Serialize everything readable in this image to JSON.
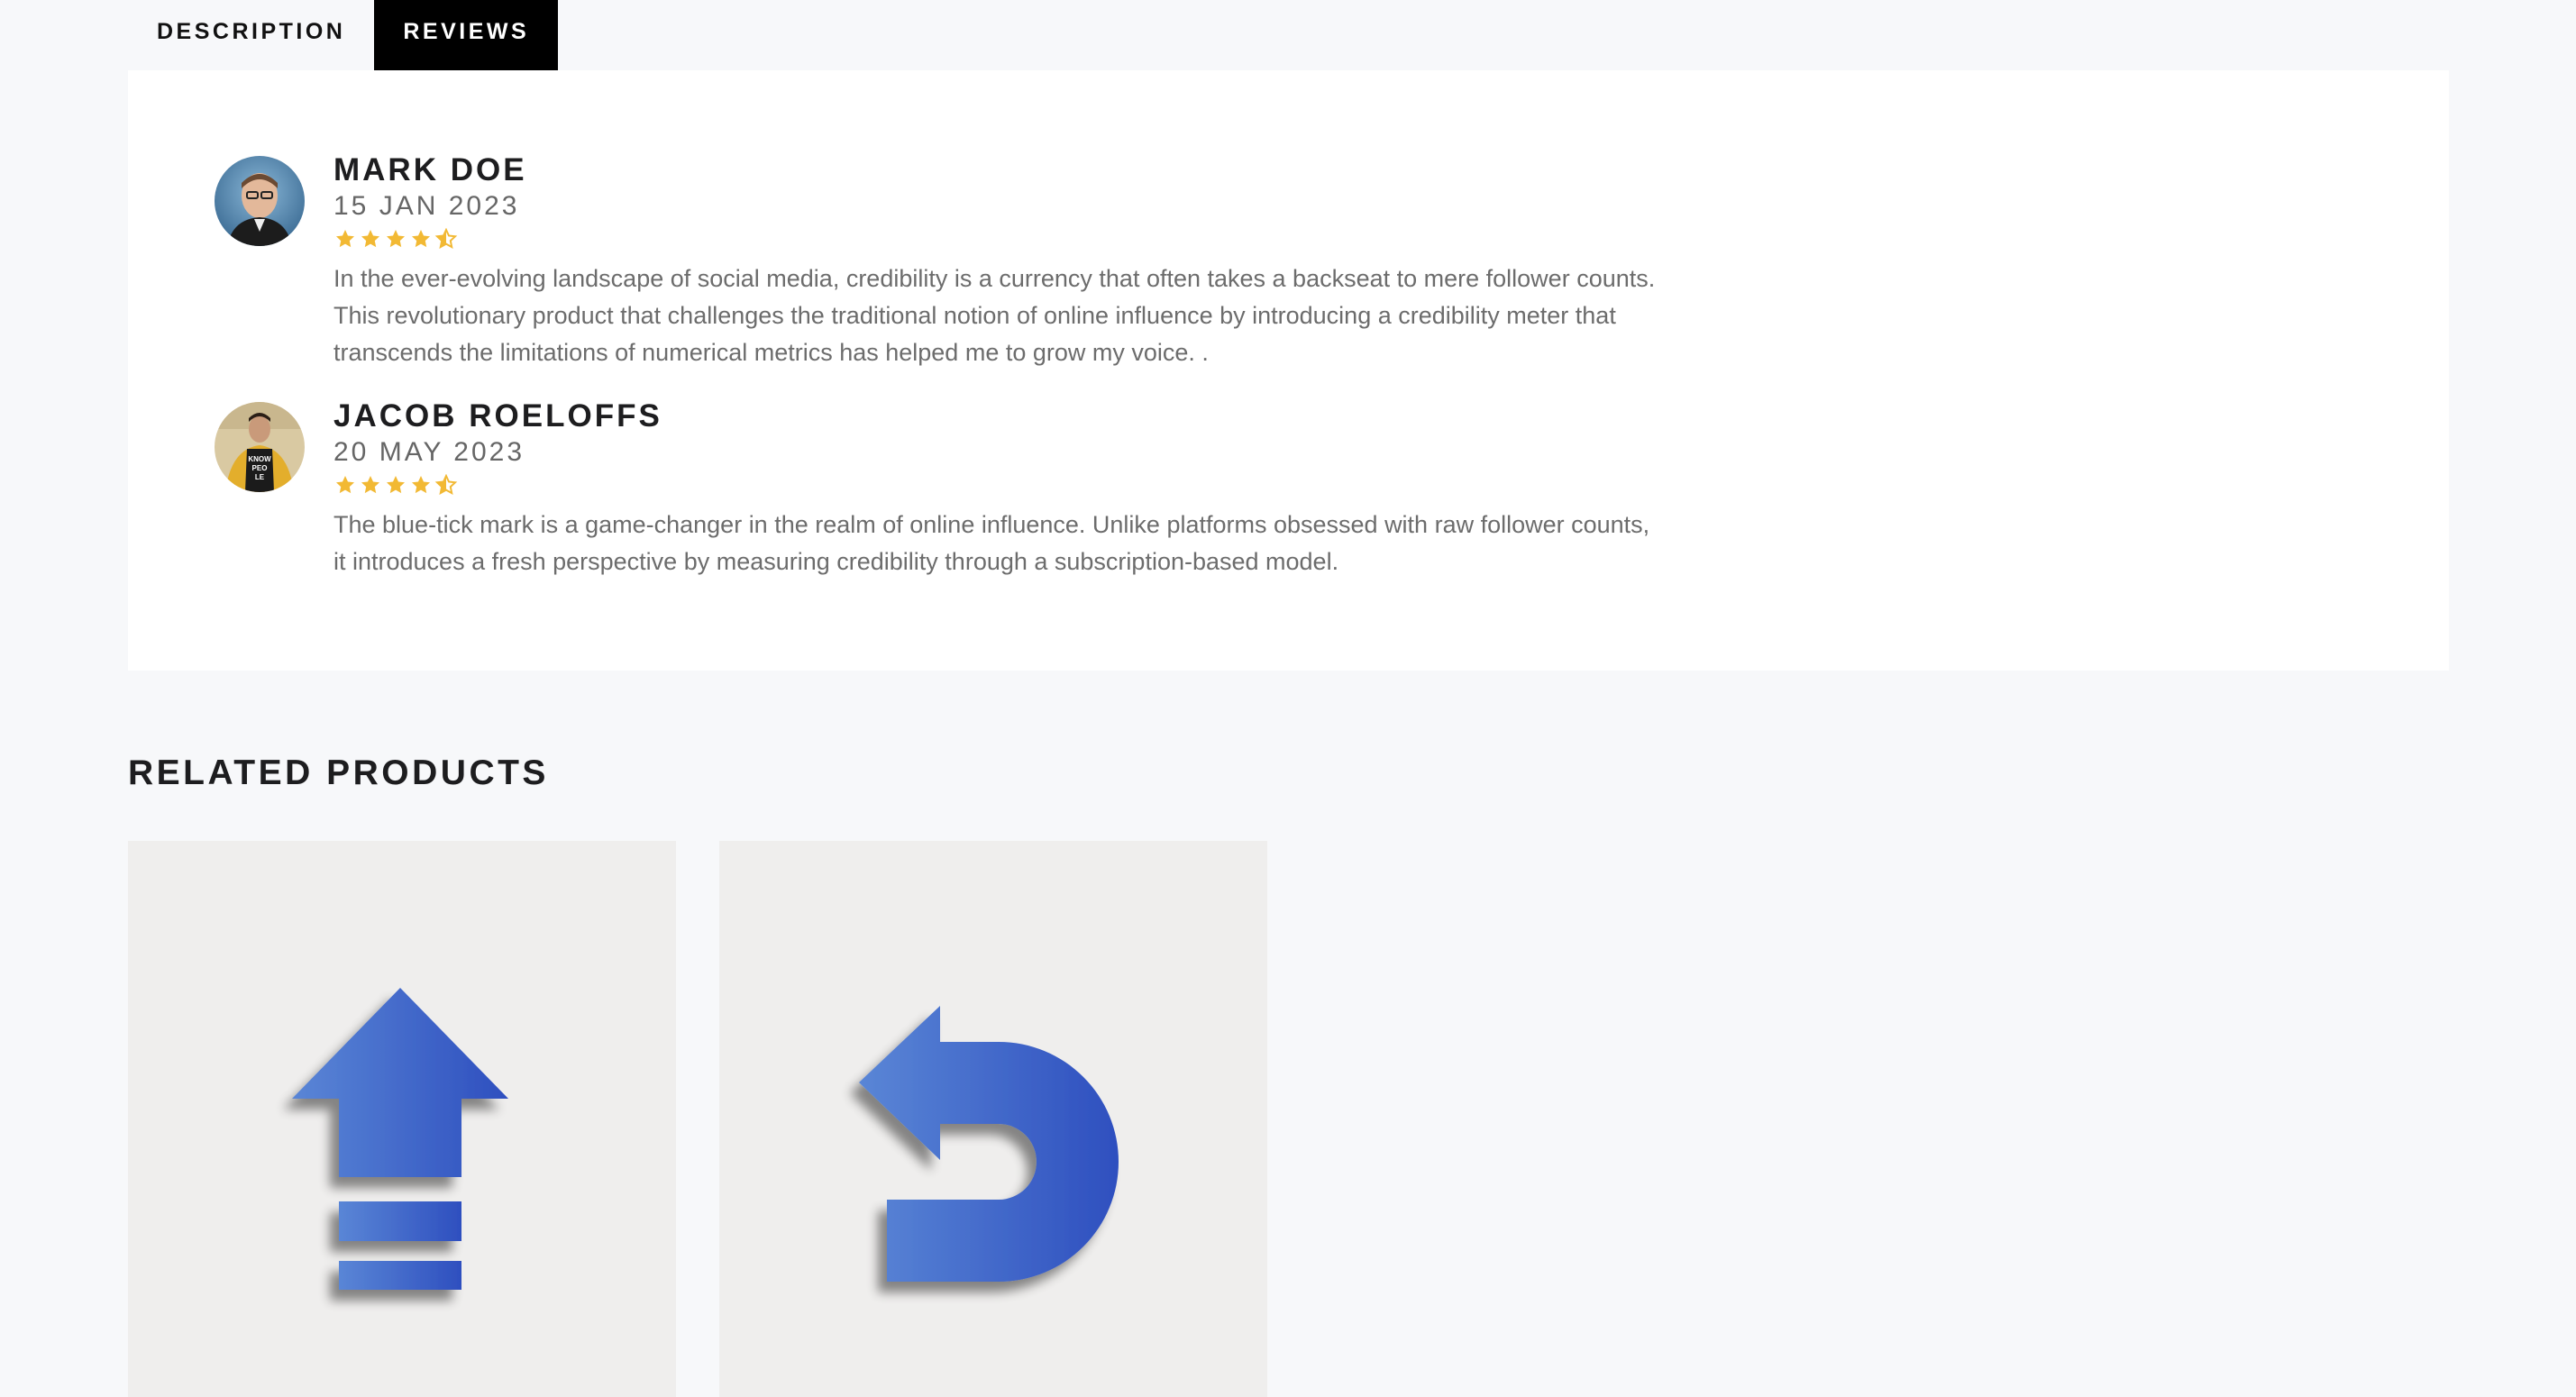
{
  "tabs": [
    {
      "label": "DESCRIPTION",
      "active": false
    },
    {
      "label": "REVIEWS",
      "active": true
    }
  ],
  "reviews": [
    {
      "name": "MARK DOE",
      "date": "15 JAN 2023",
      "rating": 4.5,
      "text": "In the ever-evolving landscape of social media, credibility is a currency that often takes a backseat to mere follower counts. This revolutionary product that challenges the traditional notion of online influence by introducing a credibility meter that transcends the limitations of numerical metrics has helped me to grow my voice. ."
    },
    {
      "name": "JACOB ROELOFFS",
      "date": "20 MAY 2023",
      "rating": 4.5,
      "text": "The blue-tick mark is a game-changer in the realm of online influence. Unlike platforms obsessed with raw follower counts, it introduces a fresh perspective by measuring credibility through a subscription-based model."
    }
  ],
  "related": {
    "title": "RELATED PRODUCTS",
    "products": [
      {
        "icon": "arrow-up-with-bars-icon"
      },
      {
        "icon": "u-turn-left-arrow-icon"
      }
    ]
  },
  "colors": {
    "star": "#f2b934",
    "active_tab_bg": "#000000",
    "icon_blue_light": "#5a86d6",
    "icon_blue_dark": "#2e4fbf",
    "card_bg": "#efeeed"
  }
}
